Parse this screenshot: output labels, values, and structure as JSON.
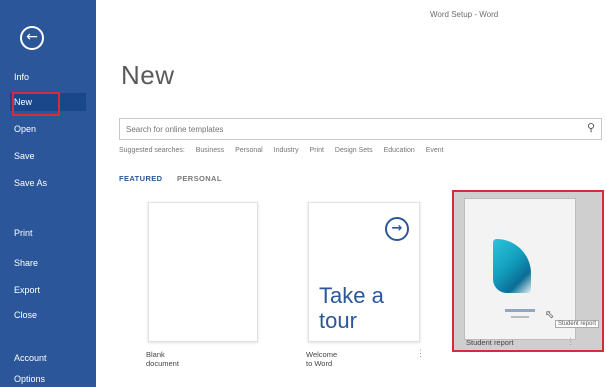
{
  "window": {
    "title": "Word Setup - Word"
  },
  "nav": {
    "back_icon": "back-arrow-icon",
    "items": [
      {
        "label": "Info"
      },
      {
        "label": "New"
      },
      {
        "label": "Open"
      },
      {
        "label": "Save"
      },
      {
        "label": "Save As"
      },
      {
        "label": "Print"
      },
      {
        "label": "Share"
      },
      {
        "label": "Export"
      },
      {
        "label": "Close"
      },
      {
        "label": "Account"
      },
      {
        "label": "Options"
      }
    ]
  },
  "main": {
    "title": "New",
    "search": {
      "placeholder": "Search for online templates"
    },
    "suggested": {
      "label": "Suggested searches:",
      "items": [
        "Business",
        "Personal",
        "Industry",
        "Print",
        "Design Sets",
        "Education",
        "Event"
      ]
    },
    "tabs": [
      {
        "label": "FEATURED"
      },
      {
        "label": "PERSONAL"
      }
    ],
    "templates": [
      {
        "label": "Blank document"
      },
      {
        "label": "Welcome to Word",
        "tour_text_1": "Take a",
        "tour_text_2": "tour"
      },
      {
        "label": "Student report",
        "tooltip": "Student report"
      }
    ]
  },
  "colors": {
    "accent": "#2b579a",
    "highlight": "#d9293b"
  }
}
